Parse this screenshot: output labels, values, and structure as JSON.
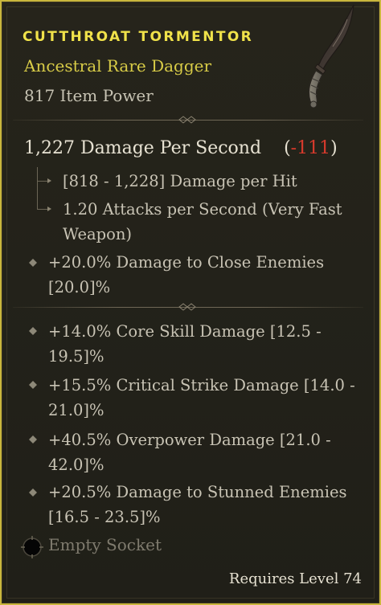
{
  "item": {
    "name": "CUTTHROAT TORMENTOR",
    "type": "Ancestral Rare Dagger",
    "item_power": "817 Item Power",
    "image_icon": "curved-dagger-icon"
  },
  "dps": {
    "value": "1,227 Damage Per Second",
    "open_paren": "(",
    "delta": "-111",
    "close_paren": ")"
  },
  "weapon_stats": [
    "[818 - 1,228] Damage per Hit",
    "1.20 Attacks per Second (Very Fast Weapon)"
  ],
  "implicit_affix": "+20.0% Damage to Close Enemies [20.0]%",
  "affixes": [
    "+14.0% Core Skill Damage [12.5 - 19.5]%",
    "+15.5% Critical Strike Damage [14.0 - 21.0]%",
    "+40.5% Overpower Damage [21.0 - 42.0]%",
    "+20.5% Damage to Stunned Enemies [16.5 - 23.5]%"
  ],
  "socket": {
    "label": "Empty Socket",
    "icon": "empty-socket-icon"
  },
  "requirement": "Requires Level 74",
  "colors": {
    "border": "#c9b63d",
    "rare_name": "#f0e24a",
    "rare_type": "#d8cc47",
    "negative": "#d83a2c",
    "text": "#c8c3b4"
  }
}
